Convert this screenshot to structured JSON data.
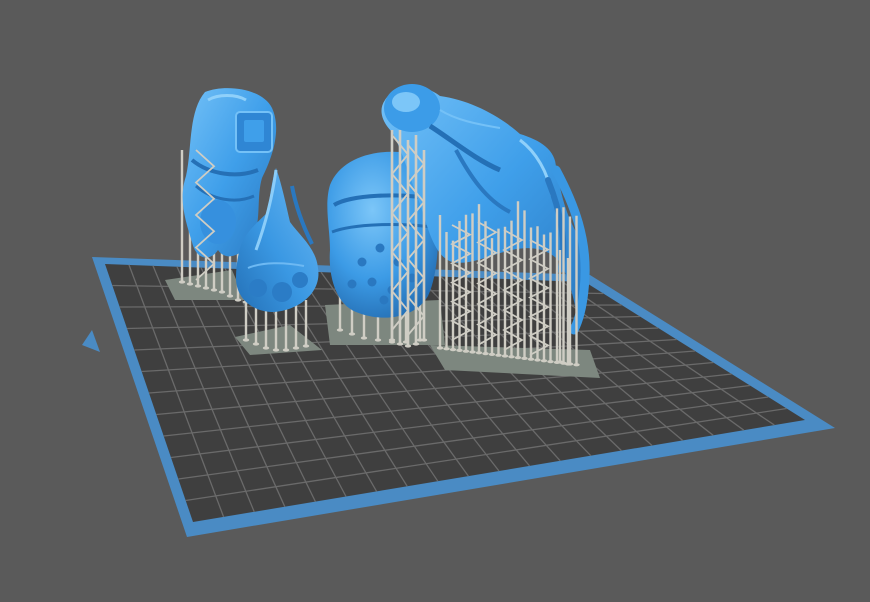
{
  "viewport": {
    "background_color": "#5a5a5a",
    "build_plate": {
      "border_color": "#4a8bc4",
      "surface_color": "#3f3f3f",
      "grid_line_color": "#6a6a6a"
    },
    "support_color": "#cfcdc4",
    "support_raft_color": "#7d877f",
    "model_color": "#3f9fea",
    "model_shadow_color": "#2a78c0",
    "model_highlight_color": "#74c1f7",
    "models": [
      {
        "name": "armored-torso-model"
      },
      {
        "name": "spiked-claw-model"
      },
      {
        "name": "spherical-pod-model"
      },
      {
        "name": "tentacle-head-model"
      }
    ]
  }
}
